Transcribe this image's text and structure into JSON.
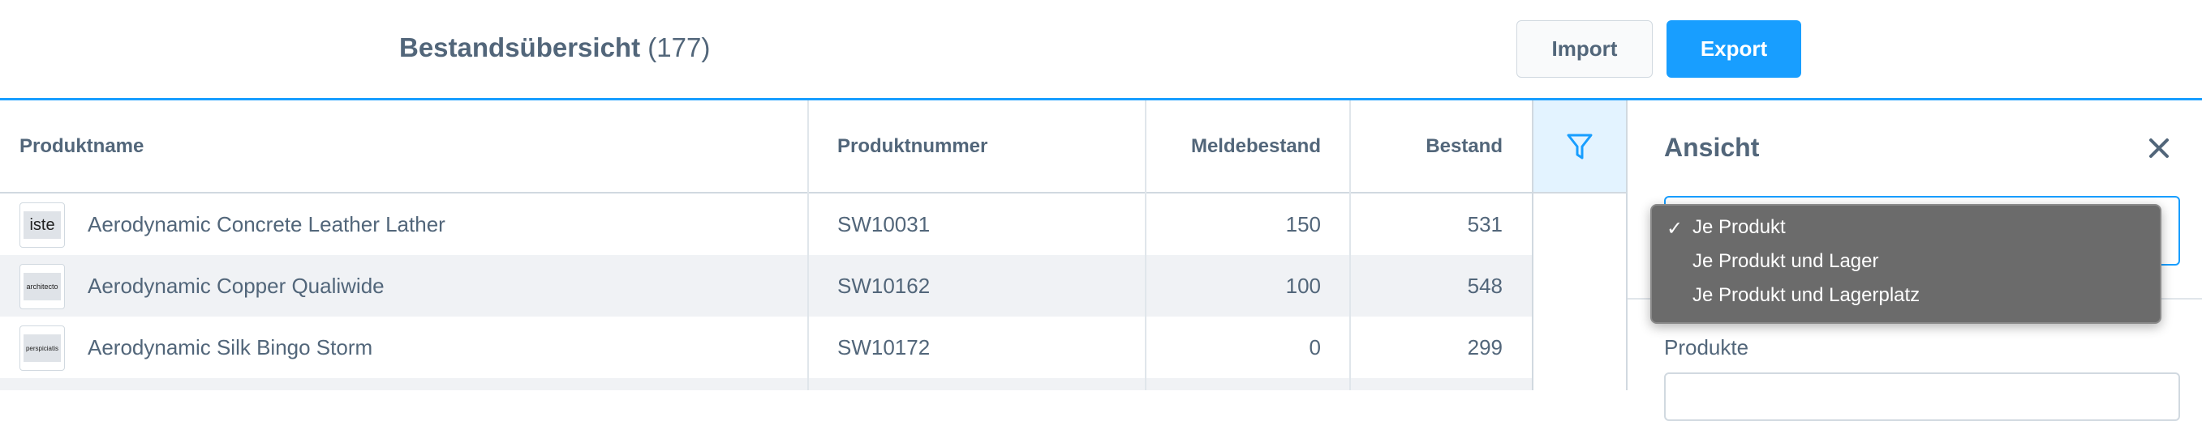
{
  "header": {
    "title": "Bestandsübersicht",
    "count": "(177)",
    "import_label": "Import",
    "export_label": "Export"
  },
  "table": {
    "columns": [
      "Produktname",
      "Produktnummer",
      "Meldebestand",
      "Bestand"
    ],
    "rows": [
      {
        "thumb": "iste",
        "name": "Aerodynamic Concrete Leather Lather",
        "number": "SW10031",
        "melde": "150",
        "bestand": "531"
      },
      {
        "thumb": "architecto",
        "name": "Aerodynamic Copper Qualiwide",
        "number": "SW10162",
        "melde": "100",
        "bestand": "548"
      },
      {
        "thumb": "perspiciatis",
        "name": "Aerodynamic Silk Bingo Storm",
        "number": "SW10172",
        "melde": "0",
        "bestand": "299"
      }
    ]
  },
  "sidebar": {
    "title": "Ansicht",
    "select_options": [
      "Je Produkt",
      "Je Produkt und Lager",
      "Je Produkt und Lagerplatz"
    ],
    "selected_option": "Je Produkt",
    "products_label": "Produkte"
  },
  "colors": {
    "accent": "#189eff",
    "text": "#52667a",
    "row_alt": "#f0f2f5",
    "dropdown_bg": "#6b6b6b"
  },
  "icons": {
    "filter": "filter-icon",
    "close": "close-icon",
    "check": "checkmark-icon"
  }
}
